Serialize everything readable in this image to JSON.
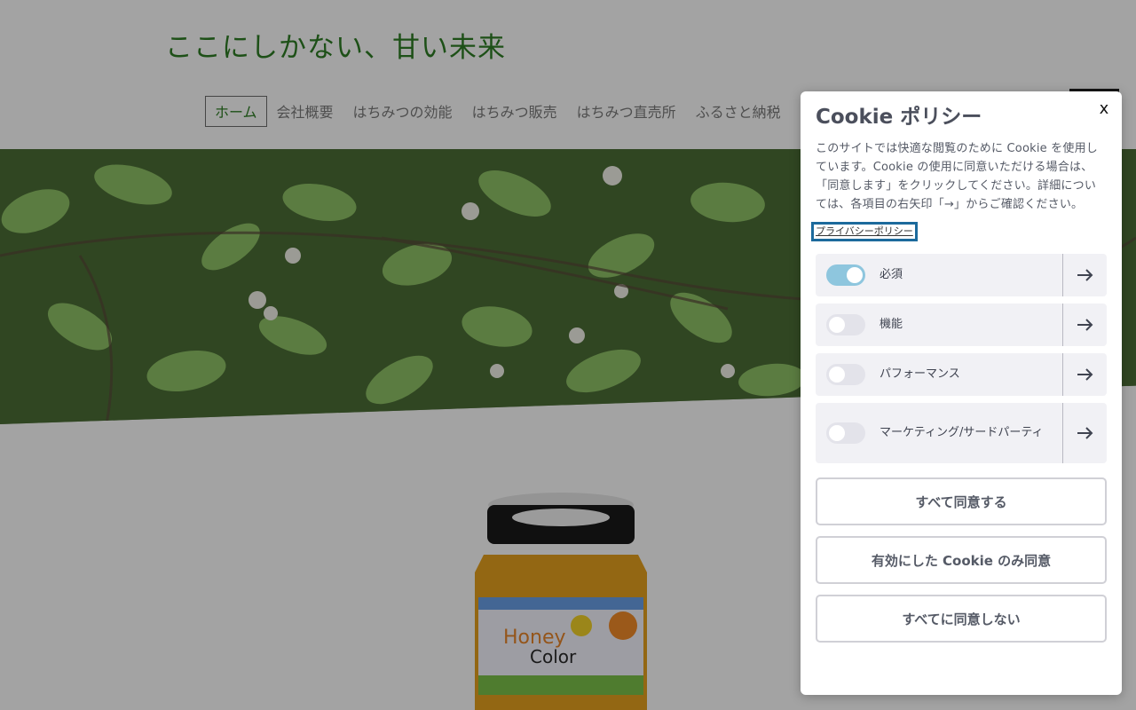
{
  "site": {
    "title": "ここにしかない、甘い未来",
    "nav": [
      "ホーム",
      "会社概要",
      "はちみつの効能",
      "はちみつ販売",
      "はちみつ直売所",
      "ふるさと納税"
    ]
  },
  "cookie_dialog": {
    "title": "Cookie ポリシー",
    "close_label": "x",
    "description": "このサイトでは快適な閲覧のために Cookie を使用しています。Cookie の使用に同意いただける場合は、「同意します」をクリックしてください。詳細については、各項目の右矢印「→」からご確認ください。",
    "privacy_link": "プライバシーポリシー",
    "categories": [
      {
        "label": "必須",
        "enabled": true
      },
      {
        "label": "機能",
        "enabled": false
      },
      {
        "label": "パフォーマンス",
        "enabled": false
      },
      {
        "label": "マーケティング/サードパーティ",
        "enabled": false
      }
    ],
    "accept_all": "すべて同意する",
    "accept_selected": "有効にした Cookie のみ同意",
    "reject_all": "すべてに同意しない"
  },
  "colors": {
    "site_title": "#2e7d24",
    "toggle_on": "#8ec6de",
    "link_focus": "#1c6a9c"
  },
  "icons": {
    "arrow": "arrow-right-icon",
    "close": "close-icon"
  }
}
